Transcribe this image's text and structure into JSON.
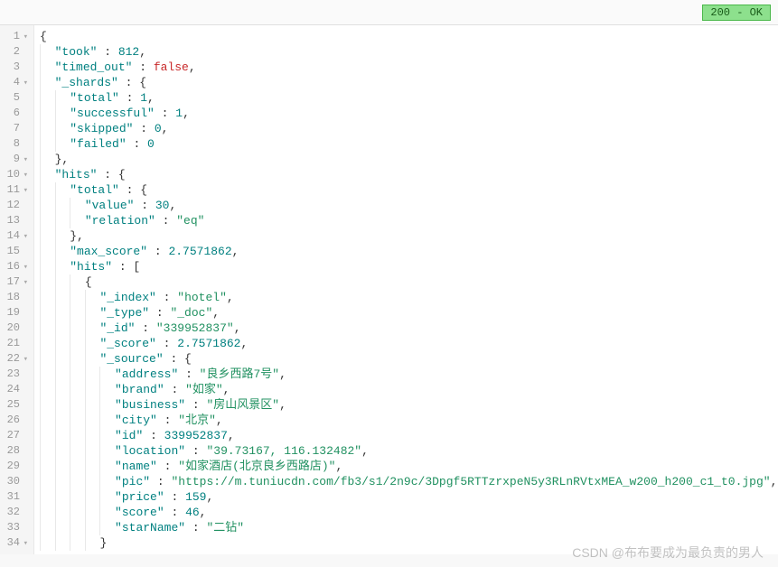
{
  "status": {
    "code": "200",
    "text": "OK",
    "label": "200 - OK"
  },
  "watermark": "CSDN @布布要成为最负责的男人",
  "foldableLines": [
    1,
    4,
    9,
    10,
    11,
    14,
    16,
    17,
    22,
    34
  ],
  "json": {
    "took": 812,
    "timed_out": false,
    "_shards": {
      "total": 1,
      "successful": 1,
      "skipped": 0,
      "failed": 0
    },
    "hits": {
      "total": {
        "value": 30,
        "relation": "eq"
      },
      "max_score": 2.7571862,
      "hits": [
        {
          "_index": "hotel",
          "_type": "_doc",
          "_id": "339952837",
          "_score": 2.7571862,
          "_source": {
            "address": "良乡西路7号",
            "brand": "如家",
            "business": "房山风景区",
            "city": "北京",
            "id": 339952837,
            "location": "39.73167, 116.132482",
            "name": "如家酒店(北京良乡西路店)",
            "pic": "https://m.tuniucdn.com/fb3/s1/2n9c/3Dpgf5RTTzrxpeN5y3RLnRVtxMEA_w200_h200_c1_t0.jpg",
            "price": 159,
            "score": 46,
            "starName": "二钻"
          }
        }
      ]
    }
  },
  "lines": [
    {
      "n": 1,
      "indent": 0,
      "tokens": [
        {
          "t": "punct",
          "v": "{"
        }
      ]
    },
    {
      "n": 2,
      "indent": 1,
      "tokens": [
        {
          "t": "key",
          "v": "\"took\""
        },
        {
          "t": "punct",
          "v": " : "
        },
        {
          "t": "number",
          "v": "812"
        },
        {
          "t": "punct",
          "v": ","
        }
      ]
    },
    {
      "n": 3,
      "indent": 1,
      "tokens": [
        {
          "t": "key",
          "v": "\"timed_out\""
        },
        {
          "t": "punct",
          "v": " : "
        },
        {
          "t": "bool",
          "v": "false"
        },
        {
          "t": "punct",
          "v": ","
        }
      ]
    },
    {
      "n": 4,
      "indent": 1,
      "tokens": [
        {
          "t": "key",
          "v": "\"_shards\""
        },
        {
          "t": "punct",
          "v": " : {"
        }
      ]
    },
    {
      "n": 5,
      "indent": 2,
      "tokens": [
        {
          "t": "key",
          "v": "\"total\""
        },
        {
          "t": "punct",
          "v": " : "
        },
        {
          "t": "number",
          "v": "1"
        },
        {
          "t": "punct",
          "v": ","
        }
      ]
    },
    {
      "n": 6,
      "indent": 2,
      "tokens": [
        {
          "t": "key",
          "v": "\"successful\""
        },
        {
          "t": "punct",
          "v": " : "
        },
        {
          "t": "number",
          "v": "1"
        },
        {
          "t": "punct",
          "v": ","
        }
      ]
    },
    {
      "n": 7,
      "indent": 2,
      "tokens": [
        {
          "t": "key",
          "v": "\"skipped\""
        },
        {
          "t": "punct",
          "v": " : "
        },
        {
          "t": "number",
          "v": "0"
        },
        {
          "t": "punct",
          "v": ","
        }
      ]
    },
    {
      "n": 8,
      "indent": 2,
      "tokens": [
        {
          "t": "key",
          "v": "\"failed\""
        },
        {
          "t": "punct",
          "v": " : "
        },
        {
          "t": "number",
          "v": "0"
        }
      ]
    },
    {
      "n": 9,
      "indent": 1,
      "tokens": [
        {
          "t": "punct",
          "v": "},"
        }
      ]
    },
    {
      "n": 10,
      "indent": 1,
      "tokens": [
        {
          "t": "key",
          "v": "\"hits\""
        },
        {
          "t": "punct",
          "v": " : {"
        }
      ]
    },
    {
      "n": 11,
      "indent": 2,
      "tokens": [
        {
          "t": "key",
          "v": "\"total\""
        },
        {
          "t": "punct",
          "v": " : {"
        }
      ]
    },
    {
      "n": 12,
      "indent": 3,
      "tokens": [
        {
          "t": "key",
          "v": "\"value\""
        },
        {
          "t": "punct",
          "v": " : "
        },
        {
          "t": "number",
          "v": "30"
        },
        {
          "t": "punct",
          "v": ","
        }
      ]
    },
    {
      "n": 13,
      "indent": 3,
      "tokens": [
        {
          "t": "key",
          "v": "\"relation\""
        },
        {
          "t": "punct",
          "v": " : "
        },
        {
          "t": "string",
          "v": "\"eq\""
        }
      ]
    },
    {
      "n": 14,
      "indent": 2,
      "tokens": [
        {
          "t": "punct",
          "v": "},"
        }
      ]
    },
    {
      "n": 15,
      "indent": 2,
      "tokens": [
        {
          "t": "key",
          "v": "\"max_score\""
        },
        {
          "t": "punct",
          "v": " : "
        },
        {
          "t": "number",
          "v": "2.7571862"
        },
        {
          "t": "punct",
          "v": ","
        }
      ]
    },
    {
      "n": 16,
      "indent": 2,
      "tokens": [
        {
          "t": "key",
          "v": "\"hits\""
        },
        {
          "t": "punct",
          "v": " : ["
        }
      ]
    },
    {
      "n": 17,
      "indent": 3,
      "tokens": [
        {
          "t": "punct",
          "v": "{"
        }
      ]
    },
    {
      "n": 18,
      "indent": 4,
      "tokens": [
        {
          "t": "key",
          "v": "\"_index\""
        },
        {
          "t": "punct",
          "v": " : "
        },
        {
          "t": "string",
          "v": "\"hotel\""
        },
        {
          "t": "punct",
          "v": ","
        }
      ]
    },
    {
      "n": 19,
      "indent": 4,
      "tokens": [
        {
          "t": "key",
          "v": "\"_type\""
        },
        {
          "t": "punct",
          "v": " : "
        },
        {
          "t": "string",
          "v": "\"_doc\""
        },
        {
          "t": "punct",
          "v": ","
        }
      ]
    },
    {
      "n": 20,
      "indent": 4,
      "tokens": [
        {
          "t": "key",
          "v": "\"_id\""
        },
        {
          "t": "punct",
          "v": " : "
        },
        {
          "t": "string",
          "v": "\"339952837\""
        },
        {
          "t": "punct",
          "v": ","
        }
      ]
    },
    {
      "n": 21,
      "indent": 4,
      "tokens": [
        {
          "t": "key",
          "v": "\"_score\""
        },
        {
          "t": "punct",
          "v": " : "
        },
        {
          "t": "number",
          "v": "2.7571862"
        },
        {
          "t": "punct",
          "v": ","
        }
      ]
    },
    {
      "n": 22,
      "indent": 4,
      "tokens": [
        {
          "t": "key",
          "v": "\"_source\""
        },
        {
          "t": "punct",
          "v": " : {"
        }
      ]
    },
    {
      "n": 23,
      "indent": 5,
      "tokens": [
        {
          "t": "key",
          "v": "\"address\""
        },
        {
          "t": "punct",
          "v": " : "
        },
        {
          "t": "string",
          "v": "\"良乡西路7号\""
        },
        {
          "t": "punct",
          "v": ","
        }
      ]
    },
    {
      "n": 24,
      "indent": 5,
      "tokens": [
        {
          "t": "key",
          "v": "\"brand\""
        },
        {
          "t": "punct",
          "v": " : "
        },
        {
          "t": "string",
          "v": "\"如家\""
        },
        {
          "t": "punct",
          "v": ","
        }
      ]
    },
    {
      "n": 25,
      "indent": 5,
      "tokens": [
        {
          "t": "key",
          "v": "\"business\""
        },
        {
          "t": "punct",
          "v": " : "
        },
        {
          "t": "string",
          "v": "\"房山风景区\""
        },
        {
          "t": "punct",
          "v": ","
        }
      ]
    },
    {
      "n": 26,
      "indent": 5,
      "tokens": [
        {
          "t": "key",
          "v": "\"city\""
        },
        {
          "t": "punct",
          "v": " : "
        },
        {
          "t": "string",
          "v": "\"北京\""
        },
        {
          "t": "punct",
          "v": ","
        }
      ]
    },
    {
      "n": 27,
      "indent": 5,
      "tokens": [
        {
          "t": "key",
          "v": "\"id\""
        },
        {
          "t": "punct",
          "v": " : "
        },
        {
          "t": "number",
          "v": "339952837"
        },
        {
          "t": "punct",
          "v": ","
        }
      ]
    },
    {
      "n": 28,
      "indent": 5,
      "tokens": [
        {
          "t": "key",
          "v": "\"location\""
        },
        {
          "t": "punct",
          "v": " : "
        },
        {
          "t": "string",
          "v": "\"39.73167, 116.132482\""
        },
        {
          "t": "punct",
          "v": ","
        }
      ]
    },
    {
      "n": 29,
      "indent": 5,
      "tokens": [
        {
          "t": "key",
          "v": "\"name\""
        },
        {
          "t": "punct",
          "v": " : "
        },
        {
          "t": "string",
          "v": "\"如家酒店(北京良乡西路店)\""
        },
        {
          "t": "punct",
          "v": ","
        }
      ]
    },
    {
      "n": 30,
      "indent": 5,
      "tokens": [
        {
          "t": "key",
          "v": "\"pic\""
        },
        {
          "t": "punct",
          "v": " : "
        },
        {
          "t": "string",
          "v": "\"https://m.tuniucdn.com/fb3/s1/2n9c/3Dpgf5RTTzrxpeN5y3RLnRVtxMEA_w200_h200_c1_t0.jpg\""
        },
        {
          "t": "punct",
          "v": ","
        }
      ]
    },
    {
      "n": 31,
      "indent": 5,
      "tokens": [
        {
          "t": "key",
          "v": "\"price\""
        },
        {
          "t": "punct",
          "v": " : "
        },
        {
          "t": "number",
          "v": "159"
        },
        {
          "t": "punct",
          "v": ","
        }
      ]
    },
    {
      "n": 32,
      "indent": 5,
      "tokens": [
        {
          "t": "key",
          "v": "\"score\""
        },
        {
          "t": "punct",
          "v": " : "
        },
        {
          "t": "number",
          "v": "46"
        },
        {
          "t": "punct",
          "v": ","
        }
      ]
    },
    {
      "n": 33,
      "indent": 5,
      "tokens": [
        {
          "t": "key",
          "v": "\"starName\""
        },
        {
          "t": "punct",
          "v": " : "
        },
        {
          "t": "string",
          "v": "\"二钻\""
        }
      ]
    },
    {
      "n": 34,
      "indent": 4,
      "tokens": [
        {
          "t": "punct",
          "v": "}"
        }
      ]
    }
  ]
}
